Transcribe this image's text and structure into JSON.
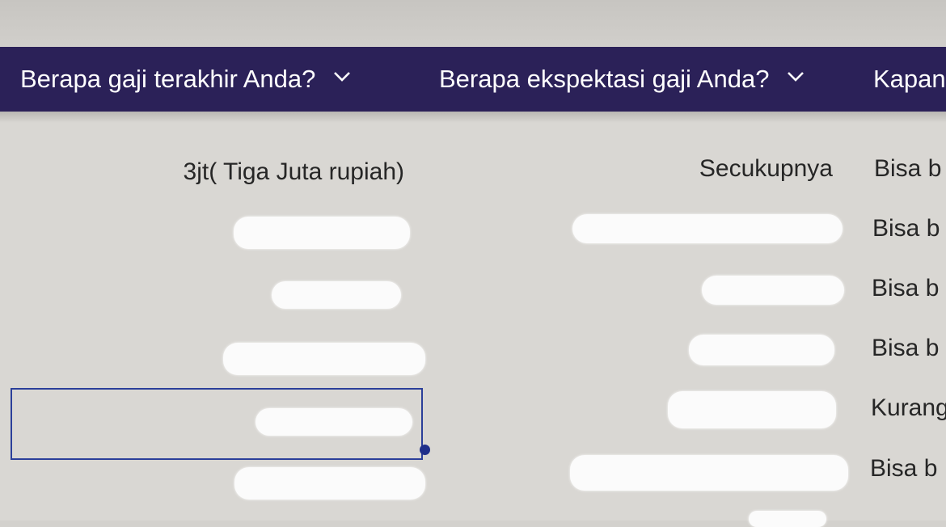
{
  "columns": [
    {
      "label": "Berapa gaji terakhir Anda?",
      "icon": "chevron-down-icon"
    },
    {
      "label": "Berapa ekspektasi gaji Anda?",
      "icon": "chevron-down-icon"
    },
    {
      "label": "Kapan"
    }
  ],
  "rows": [
    {
      "last_salary": "3jt( Tiga Juta rupiah)",
      "expected_salary": "Secukupnya",
      "availability": "Bisa b"
    },
    {
      "last_salary": "",
      "expected_salary": "",
      "availability": "Bisa b"
    },
    {
      "last_salary": "",
      "expected_salary": "",
      "availability": "Bisa b"
    },
    {
      "last_salary": "",
      "expected_salary": "",
      "availability": "Bisa b"
    },
    {
      "last_salary": "",
      "expected_salary": "",
      "availability": "Kurang"
    },
    {
      "last_salary": "",
      "expected_salary": "",
      "availability": "Bisa b"
    }
  ],
  "colors": {
    "header_bg": "#2b2158",
    "header_text": "#ffffff",
    "selection_border": "#2b3f9a"
  }
}
